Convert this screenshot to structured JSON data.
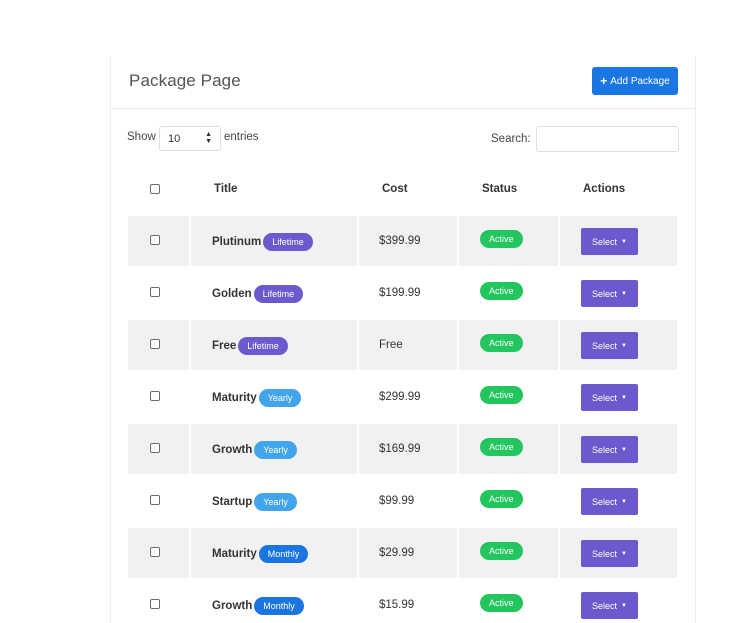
{
  "header": {
    "title": "Package Page",
    "add_button_label": "Add Package",
    "add_button_icon": "+"
  },
  "controls": {
    "show_label": "Show",
    "entries_value": "10",
    "entries_label": "entries",
    "search_label": "Search:",
    "search_value": ""
  },
  "table": {
    "columns": [
      "Title",
      "Cost",
      "Status",
      "Actions"
    ],
    "rows": [
      {
        "title": "Plutinum",
        "plan": "Lifetime",
        "plan_type": "lifetime",
        "cost": "$399.99",
        "status": "Active",
        "action": "Select"
      },
      {
        "title": "Golden",
        "plan": "Lifetime",
        "plan_type": "lifetime",
        "cost": "$199.99",
        "status": "Active",
        "action": "Select"
      },
      {
        "title": "Free",
        "plan": "Lifetime",
        "plan_type": "lifetime",
        "cost": "Free",
        "status": "Active",
        "action": "Select"
      },
      {
        "title": "Maturity",
        "plan": "Yearly",
        "plan_type": "yearly",
        "cost": "$299.99",
        "status": "Active",
        "action": "Select"
      },
      {
        "title": "Growth",
        "plan": "Yearly",
        "plan_type": "yearly",
        "cost": "$169.99",
        "status": "Active",
        "action": "Select"
      },
      {
        "title": "Startup",
        "plan": "Yearly",
        "plan_type": "yearly",
        "cost": "$99.99",
        "status": "Active",
        "action": "Select"
      },
      {
        "title": "Maturity",
        "plan": "Monthly",
        "plan_type": "monthly",
        "cost": "$29.99",
        "status": "Active",
        "action": "Select"
      },
      {
        "title": "Growth",
        "plan": "Monthly",
        "plan_type": "monthly",
        "cost": "$15.99",
        "status": "Active",
        "action": "Select"
      }
    ]
  },
  "colors": {
    "primary": "#1976e3",
    "purple": "#6a5acd",
    "yearly": "#42a5ec",
    "monthly": "#1b74e0",
    "active": "#22c55e",
    "row_shade": "#f1f1f1"
  }
}
